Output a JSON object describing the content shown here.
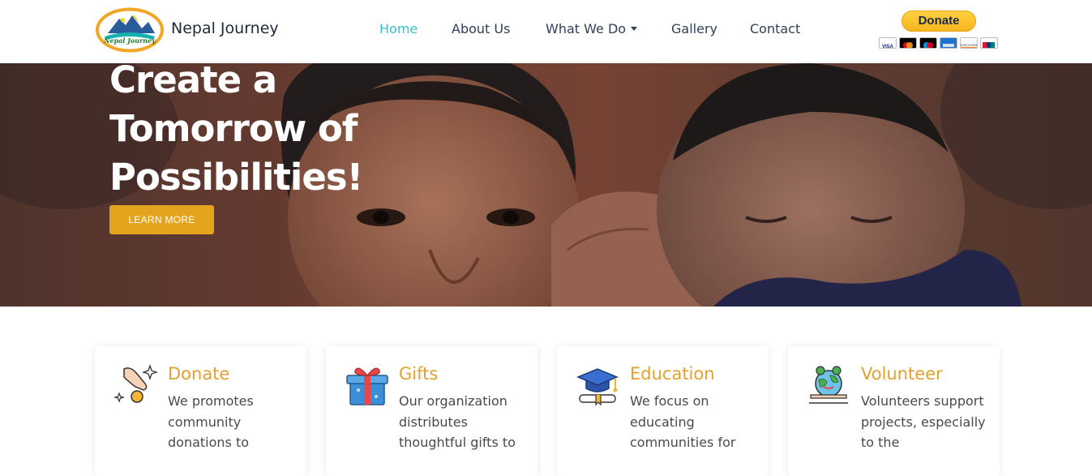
{
  "brand": {
    "name": "Nepal Journey",
    "logo_text": "Nepal Journey"
  },
  "nav": {
    "items": [
      {
        "label": "Home",
        "active": true
      },
      {
        "label": "About Us"
      },
      {
        "label": "What We Do",
        "dropdown": true
      },
      {
        "label": "Gallery"
      },
      {
        "label": "Contact"
      }
    ]
  },
  "donate": {
    "label": "Donate",
    "cards": [
      "visa-card-icon",
      "mastercard-icon",
      "maestro-icon",
      "amex-icon",
      "discover-icon",
      "unionpay-icon"
    ]
  },
  "hero": {
    "title_lines": [
      "Create a",
      "Tomorrow of",
      "Possibilities!"
    ],
    "button_label": "LEARN MORE"
  },
  "features": [
    {
      "title": "Donate",
      "text": "We promotes community donations to",
      "icon": "hand-coin-icon"
    },
    {
      "title": "Gifts",
      "text": "Our organization distributes thoughtful gifts to",
      "icon": "gift-box-icon"
    },
    {
      "title": "Education",
      "text": "We focus on educating communities for",
      "icon": "graduation-cap-icon"
    },
    {
      "title": "Volunteer",
      "text": "Volunteers support projects, especially to the",
      "icon": "earth-volunteer-icon"
    }
  ],
  "colors": {
    "accent": "#e2a130",
    "nav_active": "#2fc3cf",
    "button": "#e5a41e",
    "paypal_yellow": "#ffc439"
  }
}
